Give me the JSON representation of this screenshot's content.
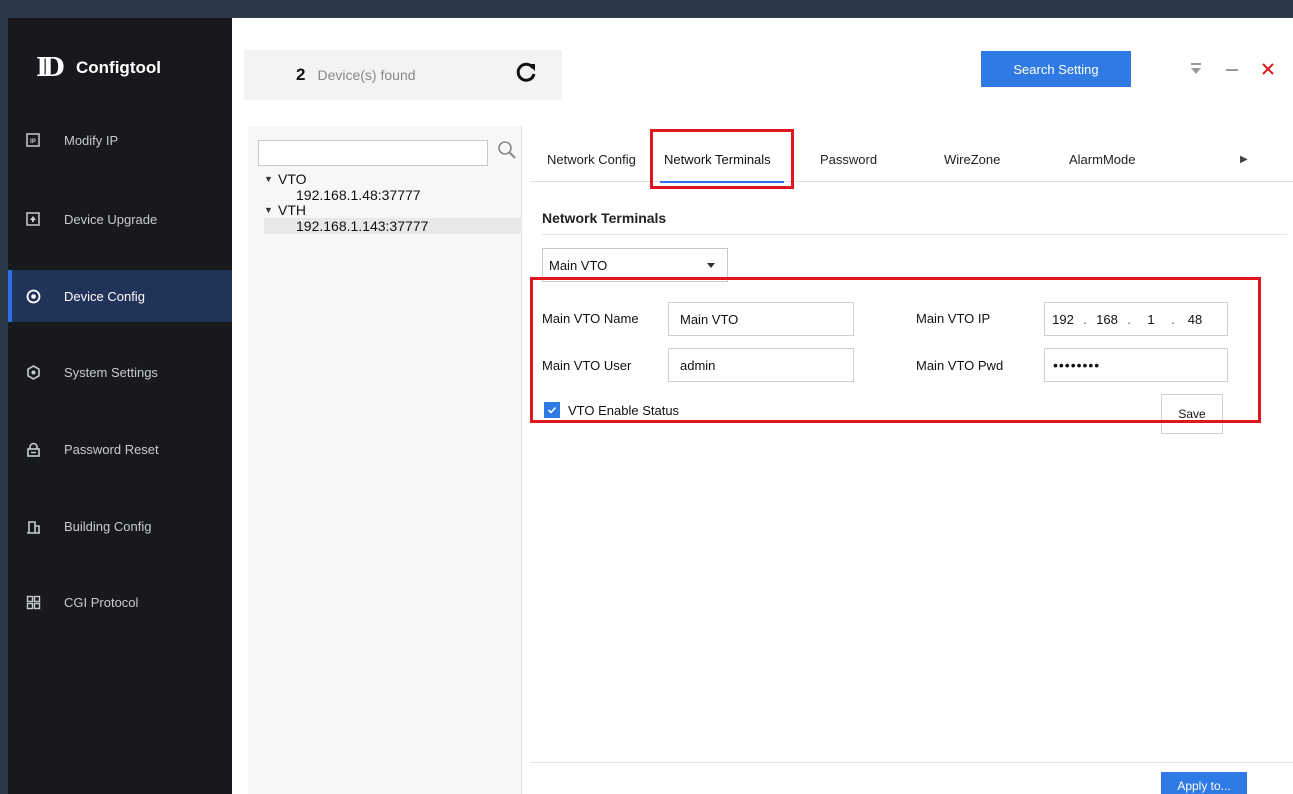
{
  "app": {
    "name": "Configtool"
  },
  "sidebar": {
    "items": [
      {
        "label": "Modify IP",
        "icon": "ip-icon"
      },
      {
        "label": "Device Upgrade",
        "icon": "upgrade-icon"
      },
      {
        "label": "Device Config",
        "icon": "config-icon",
        "active": true
      },
      {
        "label": "System Settings",
        "icon": "settings-icon"
      },
      {
        "label": "Password Reset",
        "icon": "lock-icon"
      },
      {
        "label": "Building Config",
        "icon": "building-icon"
      },
      {
        "label": "CGI Protocol",
        "icon": "cgi-icon"
      }
    ]
  },
  "header": {
    "device_count": "2",
    "device_text": "Device(s) found",
    "search_button": "Search Setting"
  },
  "device_tree": {
    "search_value": "",
    "groups": [
      {
        "label": "VTO",
        "devices": [
          "192.168.1.48:37777"
        ]
      },
      {
        "label": "VTH",
        "devices": [
          "192.168.1.143:37777"
        ]
      }
    ]
  },
  "tabs": [
    "Network Config",
    "Network Terminals",
    "Password",
    "WireZone",
    "AlarmMode"
  ],
  "active_tab": "Network Terminals",
  "section": {
    "title": "Network Terminals",
    "select_value": "Main VTO",
    "fields": {
      "name_label": "Main VTO Name",
      "name_value": "Main VTO",
      "user_label": "Main VTO User",
      "user_value": "admin",
      "ip_label": "Main VTO IP",
      "ip_octets": [
        "192",
        "168",
        "1",
        "48"
      ],
      "pwd_label": "Main VTO Pwd",
      "pwd_value": "••••••••"
    },
    "enable_label": "VTO Enable Status",
    "enable_checked": true,
    "save_label": "Save"
  },
  "footer": {
    "apply_label": "Apply to..."
  },
  "colors": {
    "accent": "#2f7ae5",
    "sidebar_bg": "#17191c",
    "highlight": "#e0161e"
  }
}
